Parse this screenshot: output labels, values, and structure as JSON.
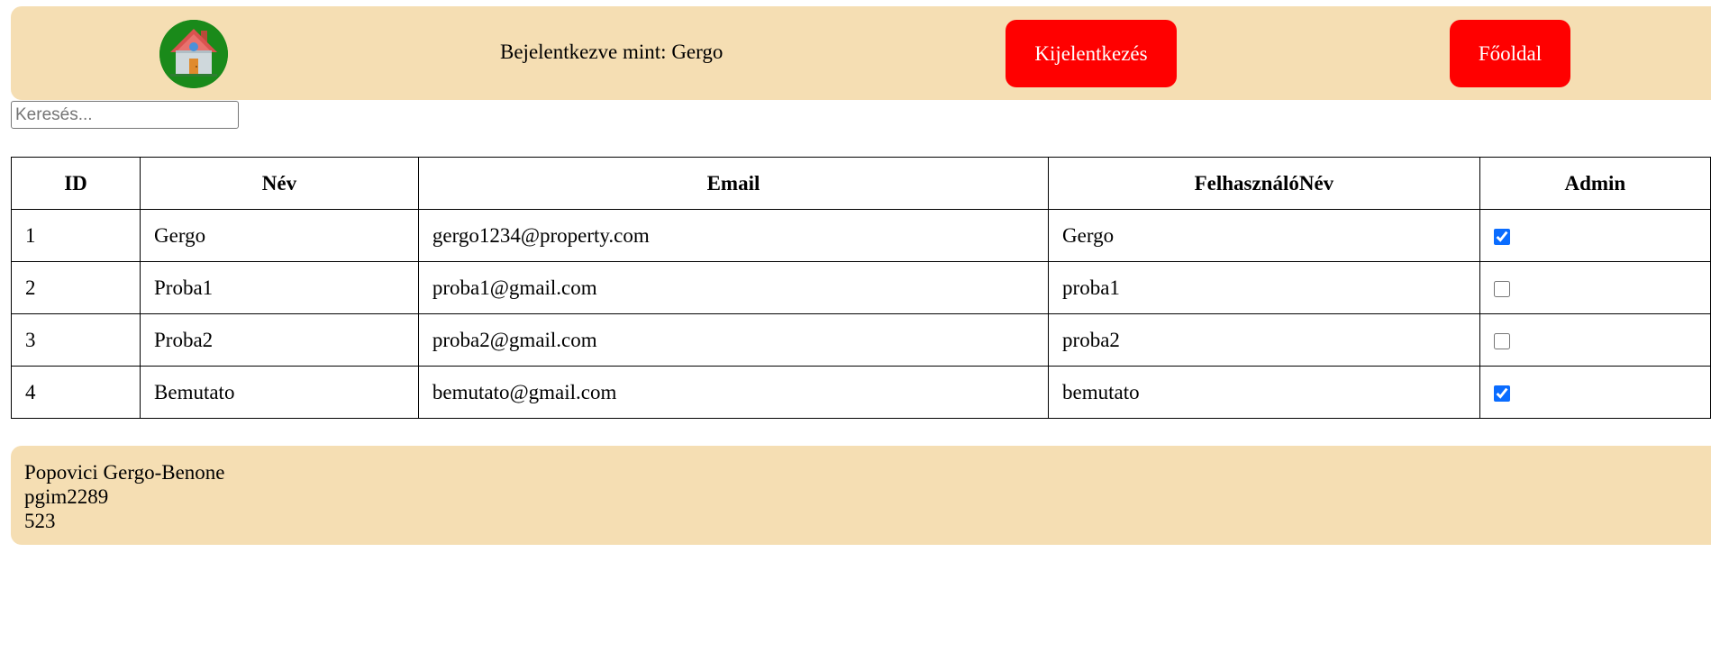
{
  "header": {
    "logo_icon": "house-icon",
    "logged_in_text": "Bejelentkezve mint: Gergo",
    "logout_label": "Kijelentkezés",
    "home_label": "Főoldal"
  },
  "search": {
    "placeholder": "Keresés..."
  },
  "table": {
    "columns": [
      "ID",
      "Név",
      "Email",
      "FelhasználóNév",
      "Admin"
    ],
    "rows": [
      {
        "id": "1",
        "name": "Gergo",
        "email": "gergo1234@property.com",
        "username": "Gergo",
        "admin": true
      },
      {
        "id": "2",
        "name": "Proba1",
        "email": "proba1@gmail.com",
        "username": "proba1",
        "admin": false
      },
      {
        "id": "3",
        "name": "Proba2",
        "email": "proba2@gmail.com",
        "username": "proba2",
        "admin": false
      },
      {
        "id": "4",
        "name": "Bemutato",
        "email": "bemutato@gmail.com",
        "username": "bemutato",
        "admin": true
      }
    ]
  },
  "footer": {
    "lines": [
      "Popovici Gergo-Benone",
      "pgim2289",
      "523"
    ]
  },
  "colors": {
    "header_bg": "#f5deb3",
    "button_bg": "#ff0000",
    "checkbox_accent": "#0a6cff"
  }
}
